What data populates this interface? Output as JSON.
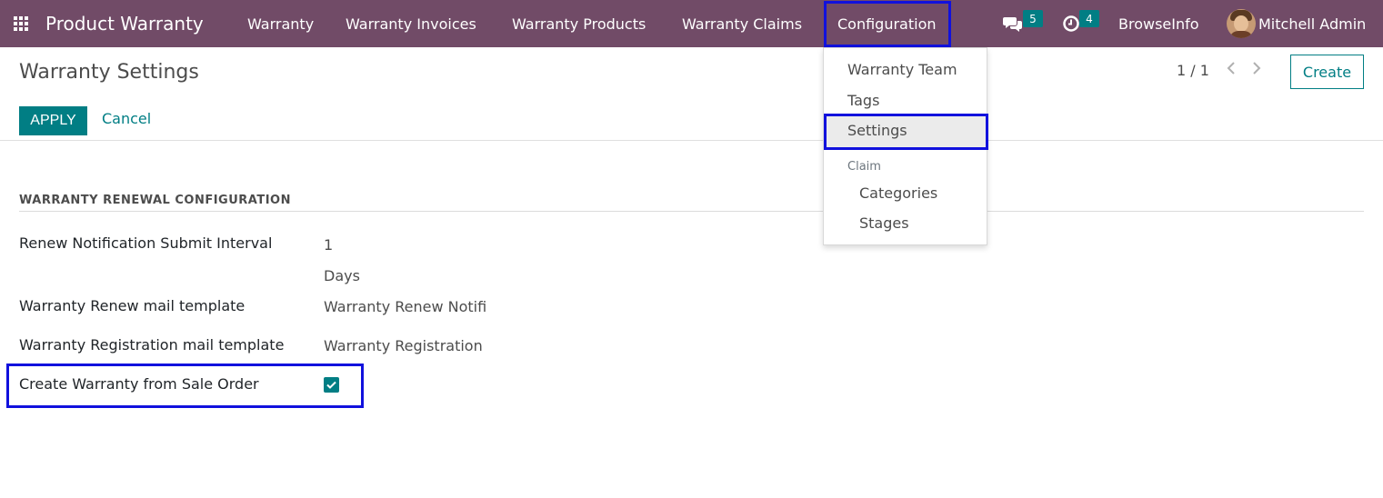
{
  "navbar": {
    "brand": "Product Warranty",
    "menu": [
      {
        "label": "Warranty"
      },
      {
        "label": "Warranty Invoices"
      },
      {
        "label": "Warranty Products"
      },
      {
        "label": "Warranty Claims"
      },
      {
        "label": "Configuration"
      }
    ],
    "messages_count": "5",
    "activities_count": "4",
    "company": "BrowseInfo",
    "user": "Mitchell Admin",
    "color": "#714B67"
  },
  "control_panel": {
    "title": "Warranty Settings",
    "apply_label": "APPLY",
    "cancel_label": "Cancel",
    "pager": "1 / 1",
    "create_label": "Create"
  },
  "form": {
    "section_title": "WARRANTY RENEWAL CONFIGURATION",
    "fields": [
      {
        "label": "Renew Notification Submit Interval",
        "value": "1",
        "unit": "Days"
      },
      {
        "label": "Warranty Renew mail template",
        "value": "Warranty Renew Notifi"
      },
      {
        "label": "Warranty Registration mail template",
        "value": "Warranty Registration"
      },
      {
        "label": "Create Warranty from Sale Order",
        "checked": true
      }
    ]
  },
  "dropdown": {
    "items": [
      {
        "label": "Warranty Team"
      },
      {
        "label": "Tags"
      },
      {
        "label": "Settings"
      }
    ],
    "group_header": "Claim",
    "group_items": [
      {
        "label": "Categories"
      },
      {
        "label": "Stages"
      }
    ]
  },
  "colors": {
    "accent": "#017e84",
    "highlight": "#1111dd"
  }
}
